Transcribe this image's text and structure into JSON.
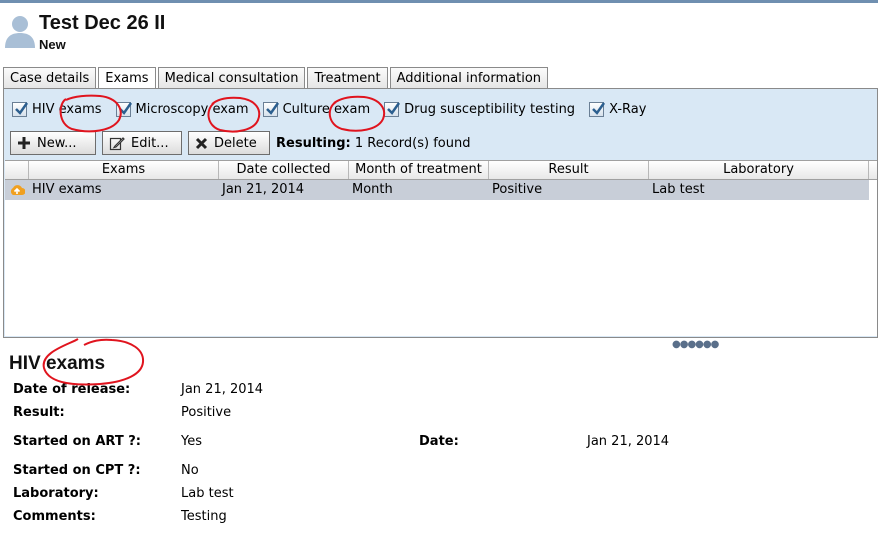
{
  "header": {
    "title": "Test Dec 26 II",
    "status": "New"
  },
  "tabs": [
    {
      "label": "Case details",
      "active": false
    },
    {
      "label": "Exams",
      "active": true
    },
    {
      "label": "Medical consultation",
      "active": false
    },
    {
      "label": "Treatment",
      "active": false
    },
    {
      "label": "Additional information",
      "active": false
    }
  ],
  "filters": [
    {
      "label": "HIV exams",
      "checked": true
    },
    {
      "label": "Microscopy exam",
      "checked": true
    },
    {
      "label": "Culture exam",
      "checked": true
    },
    {
      "label": "Drug susceptibility testing",
      "checked": true
    },
    {
      "label": "X-Ray",
      "checked": true
    }
  ],
  "toolbar": {
    "new_label": "New...",
    "edit_label": "Edit...",
    "delete_label": "Delete",
    "resulting_label": "Resulting:",
    "resulting_value": "1 Record(s) found"
  },
  "grid": {
    "columns": [
      "Exams",
      "Date collected",
      "Month of treatment",
      "Result",
      "Laboratory"
    ],
    "rows": [
      [
        "HIV exams",
        "Jan 21, 2014",
        "Month",
        "Positive",
        "Lab test"
      ]
    ]
  },
  "detail": {
    "title": "HIV exams",
    "release_label": "Date of release:",
    "release_value": "Jan 21, 2014",
    "result_label": "Result:",
    "result_value": "Positive",
    "art_label": "Started on ART ?:",
    "art_value": "Yes",
    "date_label": "Date:",
    "date_value": "Jan 21, 2014",
    "cpt_label": "Started on CPT ?:",
    "cpt_value": "No",
    "lab_label": "Laboratory:",
    "lab_value": "Lab test",
    "comments_label": "Comments:",
    "comments_value": "Testing"
  },
  "colors": {
    "panel_bg": "#d9e8f5",
    "selected_row": "#c8ced8",
    "annotation": "#e0141e",
    "row_icon": "#f0a020"
  },
  "icons": {
    "avatar": "person-icon",
    "checkbox": "check-icon",
    "new": "plus-icon",
    "edit": "pencil-icon",
    "delete": "x-icon",
    "row": "upload-warning-icon"
  }
}
